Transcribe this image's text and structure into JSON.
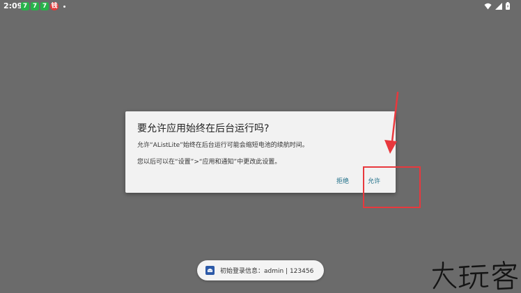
{
  "status_bar": {
    "time": "2:09",
    "badges": [
      "7",
      "7",
      "7",
      "钱"
    ],
    "icons": [
      "wifi-icon",
      "signal-icon",
      "battery-icon"
    ]
  },
  "dialog": {
    "title": "要允许应用始终在后台运行吗?",
    "message_1": "允许“AListLite”始终在后台运行可能会缩短电池的续航时间。",
    "message_2": "您以后可以在“设置”>“应用和通知”中更改此设置。",
    "deny_label": "拒绝",
    "allow_label": "允许"
  },
  "toast": {
    "text": "初始登录信息：admin | 123456"
  },
  "watermark": {
    "text": "大玩客"
  },
  "colors": {
    "background": "#6b6b6b",
    "dialog": "#f2f2f2",
    "button": "#1a6c86",
    "annotation": "#e8383d",
    "badge_green": "#27b24a",
    "badge_red": "#e33a3a"
  }
}
